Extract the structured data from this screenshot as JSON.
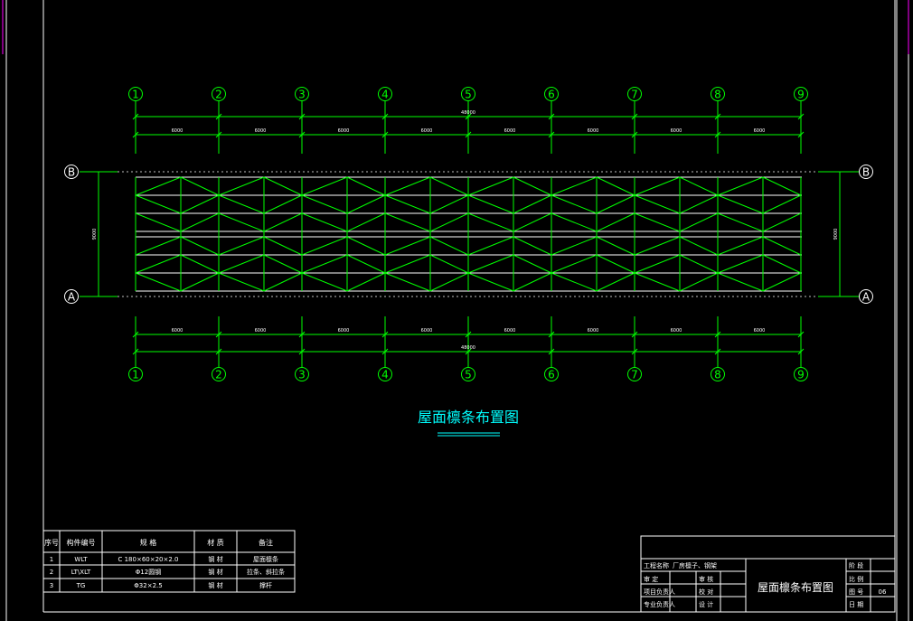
{
  "drawing_title": "屋面檩条布置图",
  "colors": {
    "background": "#000000",
    "frame": "#ffffff",
    "grid": "#00ff00",
    "purlin": "#ffffff",
    "brace": "#00ff00",
    "title": "#00ffff",
    "side_mark": "#ff00ff"
  },
  "grid_axes": {
    "numbers": [
      "1",
      "2",
      "3",
      "4",
      "5",
      "6",
      "7",
      "8",
      "9"
    ],
    "letters_top": "B",
    "letters_bottom": "A"
  },
  "dimensions": {
    "bay_label": "6000",
    "total_label": "48000",
    "span_label": "9000"
  },
  "material_table": {
    "headers": [
      "序号",
      "构件编号",
      "规 格",
      "材 质",
      "备注"
    ],
    "rows": [
      [
        "1",
        "WLT",
        "C 180×60×20×2.0",
        "钢 材",
        "屋面檩条"
      ],
      [
        "2",
        "LT\\XLT",
        "Φ12圆钢",
        "钢 材",
        "拉条、斜拉条"
      ],
      [
        "3",
        "TG",
        "Φ32×2.5",
        "钢 材",
        "撑杆"
      ]
    ]
  },
  "title_block": {
    "project_label": "工程名称",
    "project_value": "厂房檩子、钢架",
    "stage_label": "阶 段",
    "row_labels_left": [
      "审 定",
      "项目负责人",
      "专业负责人"
    ],
    "row_labels_mid": [
      "审 核",
      "校 对",
      "设 计"
    ],
    "drawing_name": "屋面檩条布置图",
    "right_labels": [
      "比 例",
      "图 号",
      "日 期"
    ],
    "drawing_number": "06"
  }
}
